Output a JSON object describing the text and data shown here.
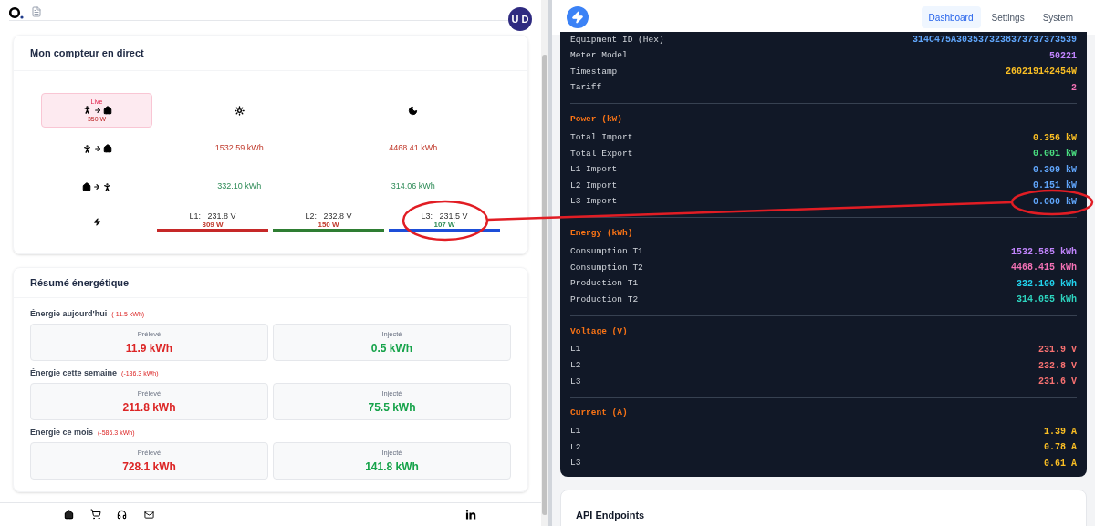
{
  "left": {
    "avatar": "U D",
    "meter": {
      "title": "Mon compteur en direct",
      "live": {
        "label": "Live",
        "value": "350 W"
      },
      "tariff_rows": [
        {
          "kind": "import",
          "values": [
            "1532.59 kWh",
            "4468.41 kWh"
          ]
        },
        {
          "kind": "export",
          "values": [
            "332.10 kWh",
            "314.06 kWh"
          ]
        }
      ],
      "phases": [
        {
          "label": "L1:",
          "voltage": "231.8 V",
          "power": {
            "text": "309 W",
            "color": "#c0392b"
          },
          "color": "#c62828"
        },
        {
          "label": "L2:",
          "voltage": "232.8 V",
          "power": {
            "text": "150 W",
            "color": "#c0392b"
          },
          "color": "#2e7d32"
        },
        {
          "label": "L3:",
          "voltage": "231.5 V",
          "power": {
            "text": "107 W",
            "color": "#2e8b57"
          },
          "color": "#1d4ed8"
        }
      ]
    },
    "summary": {
      "title": "Résumé énergétique",
      "periods": [
        {
          "label": "Énergie aujourd'hui",
          "delta": "(-11.5 kWh)",
          "items": [
            {
              "kind": "import",
              "label": "Prélevé",
              "value": "11.9 kWh"
            },
            {
              "kind": "export",
              "label": "Injecté",
              "value": "0.5 kWh"
            }
          ]
        },
        {
          "label": "Énergie cette semaine",
          "delta": "(-136.3 kWh)",
          "items": [
            {
              "kind": "import",
              "label": "Prélevé",
              "value": "211.8 kWh"
            },
            {
              "kind": "export",
              "label": "Injecté",
              "value": "75.5 kWh"
            }
          ]
        },
        {
          "label": "Énergie ce mois",
          "delta": "(-586.3 kWh)",
          "items": [
            {
              "kind": "import",
              "label": "Prélevé",
              "value": "728.1 kWh"
            },
            {
              "kind": "export",
              "label": "Injecté",
              "value": "141.8 kWh"
            }
          ]
        }
      ]
    }
  },
  "right": {
    "nav": [
      {
        "label": "Dashboard",
        "selected": true
      },
      {
        "label": "Settings",
        "selected": false
      },
      {
        "label": "System",
        "selected": false
      }
    ],
    "sections": [
      {
        "rows": [
          {
            "label": "Equipment ID (Hex)",
            "value": "314C475A3035373238373737373539",
            "color": "#60a5fa"
          },
          {
            "label": "Meter Model",
            "value": "50221",
            "color": "#c084fc"
          },
          {
            "label": "Timestamp",
            "value": "260219142454W",
            "color": "#fbbf24"
          },
          {
            "label": "Tariff",
            "value": "2",
            "color": "#f472b6"
          }
        ]
      },
      {
        "title": "Power (kW)",
        "rows": [
          {
            "label": "Total Import",
            "value": "0.356 kW",
            "color": "#fbbf24"
          },
          {
            "label": "Total Export",
            "value": "0.001 kW",
            "color": "#4ade80"
          },
          {
            "label": "L1 Import",
            "value": "0.309 kW",
            "color": "#60a5fa"
          },
          {
            "label": "L2 Import",
            "value": "0.151 kW",
            "color": "#60a5fa"
          },
          {
            "label": "L3 Import",
            "value": "0.000 kW",
            "color": "#60a5fa"
          }
        ]
      },
      {
        "title": "Energy (kWh)",
        "rows": [
          {
            "label": "Consumption T1",
            "value": "1532.585 kWh",
            "color": "#c084fc"
          },
          {
            "label": "Consumption T2",
            "value": "4468.415 kWh",
            "color": "#f472b6"
          },
          {
            "label": "Production T1",
            "value": "332.100 kWh",
            "color": "#22d3ee"
          },
          {
            "label": "Production T2",
            "value": "314.055 kWh",
            "color": "#2dd4bf"
          }
        ]
      },
      {
        "title": "Voltage (V)",
        "rows": [
          {
            "label": "L1",
            "value": "231.9 V",
            "color": "#f87171"
          },
          {
            "label": "L2",
            "value": "232.8 V",
            "color": "#f87171"
          },
          {
            "label": "L3",
            "value": "231.6 V",
            "color": "#f87171"
          }
        ]
      },
      {
        "title": "Current (A)",
        "rows": [
          {
            "label": "L1",
            "value": "1.39 A",
            "color": "#fbbf24"
          },
          {
            "label": "L2",
            "value": "0.78 A",
            "color": "#fbbf24"
          },
          {
            "label": "L3",
            "value": "0.61 A",
            "color": "#fbbf24"
          }
        ]
      }
    ],
    "api_card": {
      "title": "API Endpoints"
    }
  }
}
